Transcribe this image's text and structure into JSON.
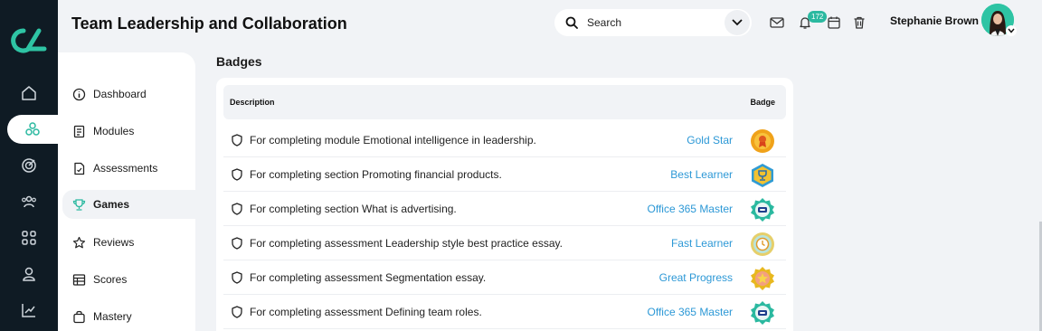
{
  "header": {
    "title": "Team Leadership and Collaboration",
    "search_label": "Search",
    "notification_count": "172",
    "user_name": "Stephanie Brown"
  },
  "rail": {
    "icons": [
      "home-icon",
      "courses-icon",
      "target-icon",
      "people-icon",
      "apps-icon",
      "user-icon",
      "analytics-icon"
    ],
    "active_index": 1
  },
  "subnav": {
    "items": [
      {
        "label": "Dashboard",
        "icon": "info-icon"
      },
      {
        "label": "Modules",
        "icon": "book-icon"
      },
      {
        "label": "Assessments",
        "icon": "document-icon"
      },
      {
        "label": "Games",
        "icon": "trophy-icon"
      },
      {
        "label": "Reviews",
        "icon": "star-icon"
      },
      {
        "label": "Scores",
        "icon": "table-icon"
      },
      {
        "label": "Mastery",
        "icon": "bag-icon"
      }
    ],
    "active_index": 3
  },
  "badges": {
    "title": "Badges",
    "columns": {
      "description": "Description",
      "badge": "Badge"
    },
    "rows": [
      {
        "description": "For completing module Emotional intelligence in leadership.",
        "badge": "Gold Star",
        "badge_color": "#f0a21a"
      },
      {
        "description": "For completing section Promoting financial products.",
        "badge": "Best Learner",
        "badge_color": "#2f9bd4"
      },
      {
        "description": "For completing section What is advertising.",
        "badge": "Office 365 Master",
        "badge_color": "#2bb9a0"
      },
      {
        "description": "For completing assessment Leadership style best practice essay.",
        "badge": "Fast Learner",
        "badge_color": "#e6cf6a"
      },
      {
        "description": "For completing assessment Segmentation essay.",
        "badge": "Great Progress",
        "badge_color": "#e8b81f"
      },
      {
        "description": "For completing assessment Defining team roles.",
        "badge": "Office 365 Master",
        "badge_color": "#2bb9a0"
      }
    ]
  },
  "colors": {
    "accent": "#2bb9a0",
    "link": "#2c98d6",
    "rail": "#0f1b24",
    "background": "#f1f3f6"
  }
}
